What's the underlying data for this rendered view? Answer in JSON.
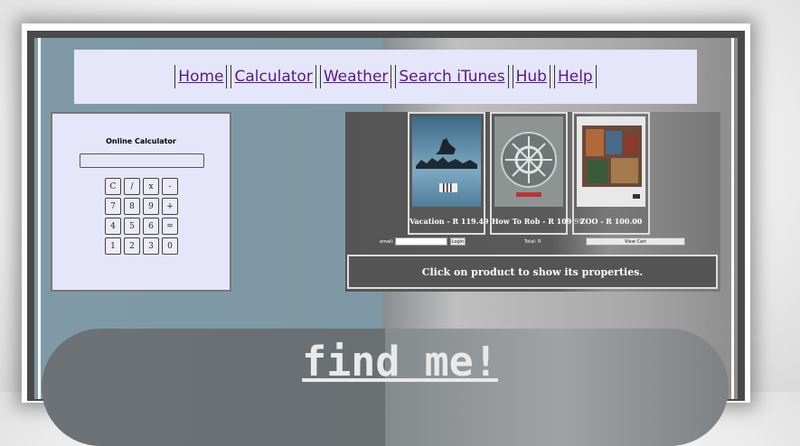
{
  "nav": {
    "items": [
      {
        "label": "Home"
      },
      {
        "label": "Calculator"
      },
      {
        "label": "Weather"
      },
      {
        "label": "Search iTunes"
      },
      {
        "label": "Hub"
      },
      {
        "label": "Help"
      }
    ]
  },
  "calculator": {
    "title": "Online Calculator",
    "display_value": "",
    "keys": [
      "C",
      "/",
      "x",
      "-",
      "7",
      "8",
      "9",
      "+",
      "4",
      "5",
      "6",
      "=",
      "1",
      "2",
      "3",
      "0"
    ]
  },
  "shop": {
    "products": [
      {
        "caption": "Vacation - R 119.49",
        "art": "album-art-vacation"
      },
      {
        "caption": "How To Rob - R 109.99",
        "art": "album-art-how-to-rob"
      },
      {
        "caption": "ZOO - R 100.00",
        "art": "album-art-zoo"
      }
    ],
    "email_label": "email:",
    "email_value": "",
    "login_label": "Login",
    "total_label": "Total: R",
    "view_cart_label": "View Cart",
    "info_text": "Click on product to show its properties."
  },
  "find": {
    "label": "find me!"
  }
}
